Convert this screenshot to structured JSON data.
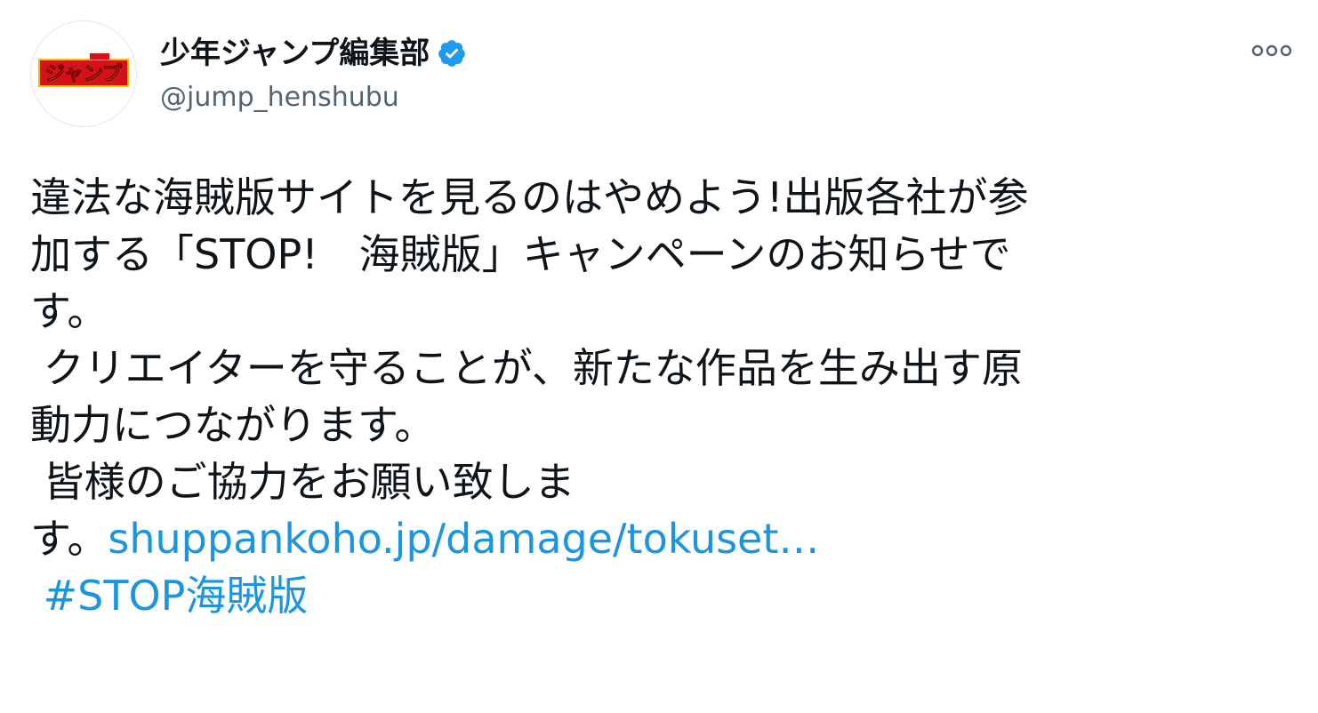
{
  "user": {
    "display_name": "少年ジャンプ編集部",
    "handle": "@jump_henshubu",
    "verified": true,
    "avatar_text": "ジャンプ"
  },
  "tweet": {
    "lines": [
      "違法な海賊版サイトを見るのはやめよう!出版各社が参",
      "加する「STOP!　海賊版」キャンペーンのお知らせで",
      "す。",
      " クリエイターを守ることが、新たな作品を生み出す原",
      "動力につながります。",
      " 皆様のご協力をお願い致しま",
      "す。"
    ],
    "link_text": "shuppankoho.jp/damage/tokuset…",
    "hashtag": " #STOP海賊版"
  },
  "colors": {
    "link": "#1b95e0",
    "verified_badge": "#1d9bf0",
    "handle": "#536471",
    "text": "#0f1419"
  },
  "icons": {
    "more": "more-horizontal-icon",
    "verified": "verified-badge-icon"
  }
}
